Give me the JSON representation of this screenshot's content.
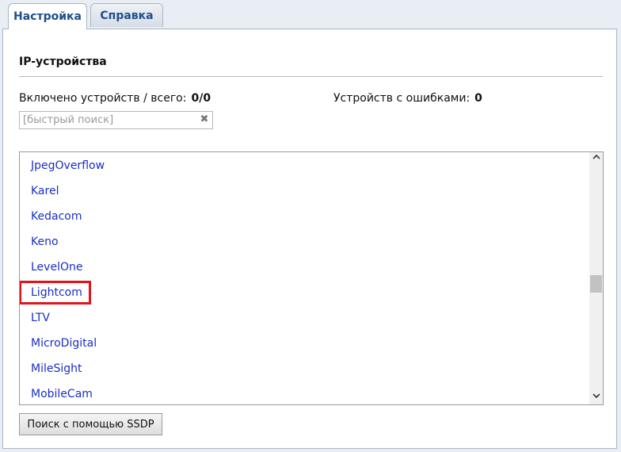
{
  "tabs": [
    {
      "label": "Настройка",
      "active": true
    },
    {
      "label": "Справка",
      "active": false
    }
  ],
  "section": {
    "title": "IP-устройства"
  },
  "stats": {
    "enabled_label": "Включено устройств / всего:",
    "enabled_value": "0/0",
    "errors_label": "Устройств с ошибками:",
    "errors_value": "0"
  },
  "search": {
    "placeholder": "[быстрый поиск]",
    "value": "",
    "clear_icon": "close-icon"
  },
  "list": {
    "items": [
      "JpegOverflow",
      "Karel",
      "Kedacom",
      "Keno",
      "LevelOne",
      "Lightcom",
      "LTV",
      "MicroDigital",
      "MileSight",
      "MobileCam"
    ],
    "highlighted": "Lightcom",
    "highlight_color": "#e0141b",
    "link_color": "#1a2ec4"
  },
  "buttons": {
    "ssdp_label": "Поиск с помощью SSDP"
  },
  "scrollbar": {
    "up_icon": "chevron-up-icon",
    "down_icon": "chevron-down-icon"
  }
}
